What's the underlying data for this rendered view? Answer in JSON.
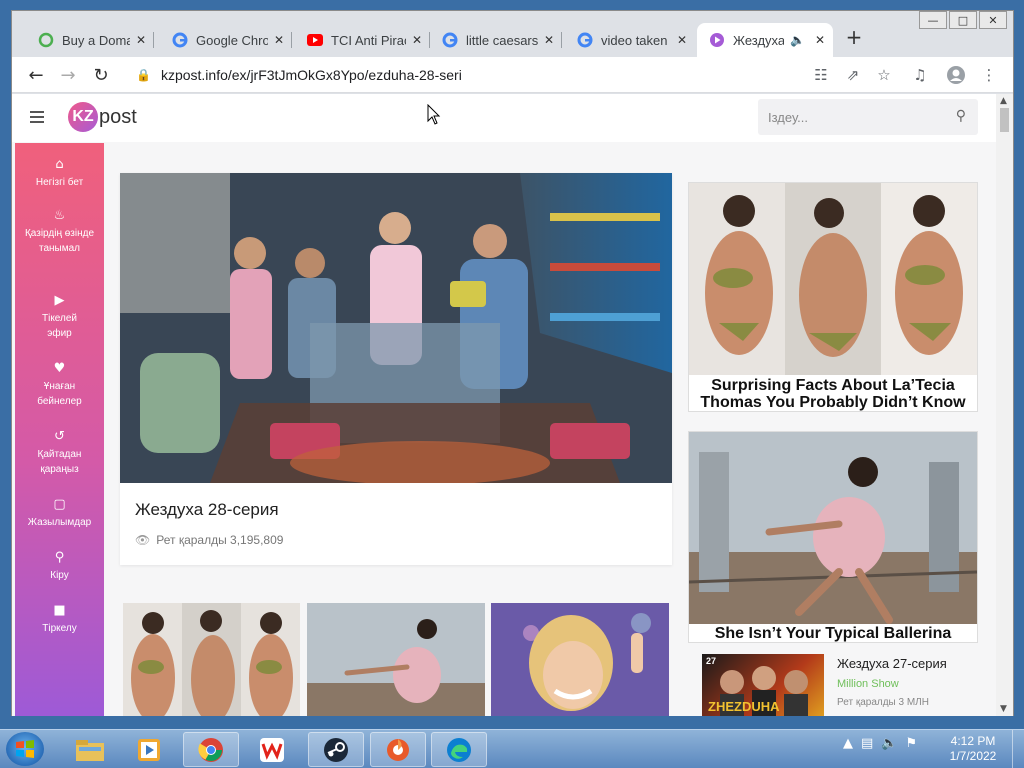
{
  "browser": {
    "tabs": [
      {
        "title": "Buy a Domai",
        "icon": "domain-site-icon"
      },
      {
        "title": "Google Chron",
        "icon": "google-icon"
      },
      {
        "title": "TCI Anti Pirac",
        "icon": "youtube-icon"
      },
      {
        "title": "little caesars",
        "icon": "google-icon"
      },
      {
        "title": "video taken o",
        "icon": "google-icon"
      },
      {
        "title": "Жездуха",
        "icon": "play-icon",
        "active": true
      }
    ],
    "url": "kzpost.info/ex/jrF3tJmOkGx8Ypo/ezduha-28-seri"
  },
  "site": {
    "logo_mark": "KZ",
    "logo_text": "post",
    "search_placeholder": "Іздеу..."
  },
  "sidebar": {
    "items": [
      {
        "label": "Негізгі бет",
        "icon": "home-icon"
      },
      {
        "label": "Қазірдің өзінде танымал",
        "icon": "fire-icon"
      },
      {
        "label": "Тікелей эфир",
        "icon": "live-icon"
      },
      {
        "label": "Ұнаған бейнелер",
        "icon": "heart-icon"
      },
      {
        "label": "Қайтадан қараңыз",
        "icon": "history-icon"
      },
      {
        "label": "Жазылымдар",
        "icon": "folder-icon"
      },
      {
        "label": "Кіру",
        "icon": "key-icon"
      },
      {
        "label": "Тіркелу",
        "icon": "lock-icon"
      }
    ]
  },
  "main": {
    "title": "Жездуха 28-серия",
    "views": "Рет қаралды 3,195,809"
  },
  "ads": [
    {
      "caption_line1": "Surprising Facts About La’Tecia",
      "caption_line2": "Thomas You Probably Didn’t Know"
    },
    {
      "caption_line1": "She Isn’t Your Typical Ballerina",
      "caption_line2": ""
    }
  ],
  "related": {
    "title": "Жездуха 27-серия",
    "channel": "Million Show",
    "views": "Рет қаралды 3 МЛН",
    "thumb_text": "ZHEZDUHA",
    "thumb_number": "27"
  },
  "taskbar": {
    "time": "4:12 PM",
    "date": "1/7/2022"
  }
}
